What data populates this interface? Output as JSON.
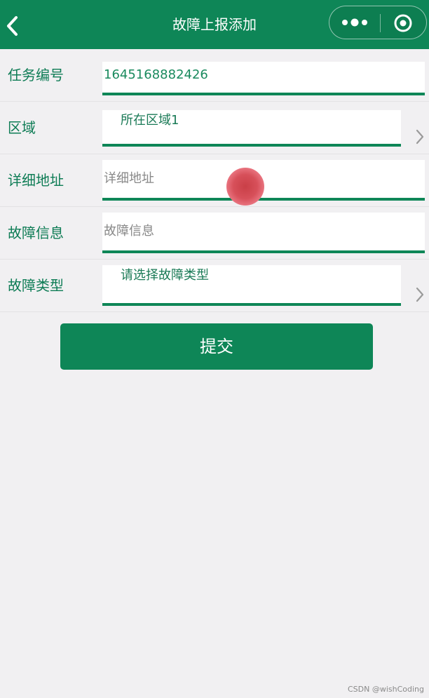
{
  "colors": {
    "brand": "#0e8657",
    "label_text": "#0e7c55",
    "background": "#f1f0f2",
    "touch_indicator": "#d7505a"
  },
  "nav": {
    "title": "故障上报添加",
    "back_icon": "chevron-left-icon",
    "more_icon": "more-dots-icon",
    "close_icon": "circle-target-icon"
  },
  "form": {
    "rows": [
      {
        "label": "任务编号",
        "value": "1645168882426",
        "type": "input"
      },
      {
        "label": "区域",
        "value": "所在区域1",
        "type": "picker"
      },
      {
        "label": "详细地址",
        "placeholder": "详细地址",
        "value": "",
        "type": "input"
      },
      {
        "label": "故障信息",
        "placeholder": "故障信息",
        "value": "",
        "type": "input"
      },
      {
        "label": "故障类型",
        "value": "请选择故障类型",
        "type": "picker"
      }
    ],
    "submit_label": "提交"
  },
  "watermark": "CSDN @wishCoding"
}
